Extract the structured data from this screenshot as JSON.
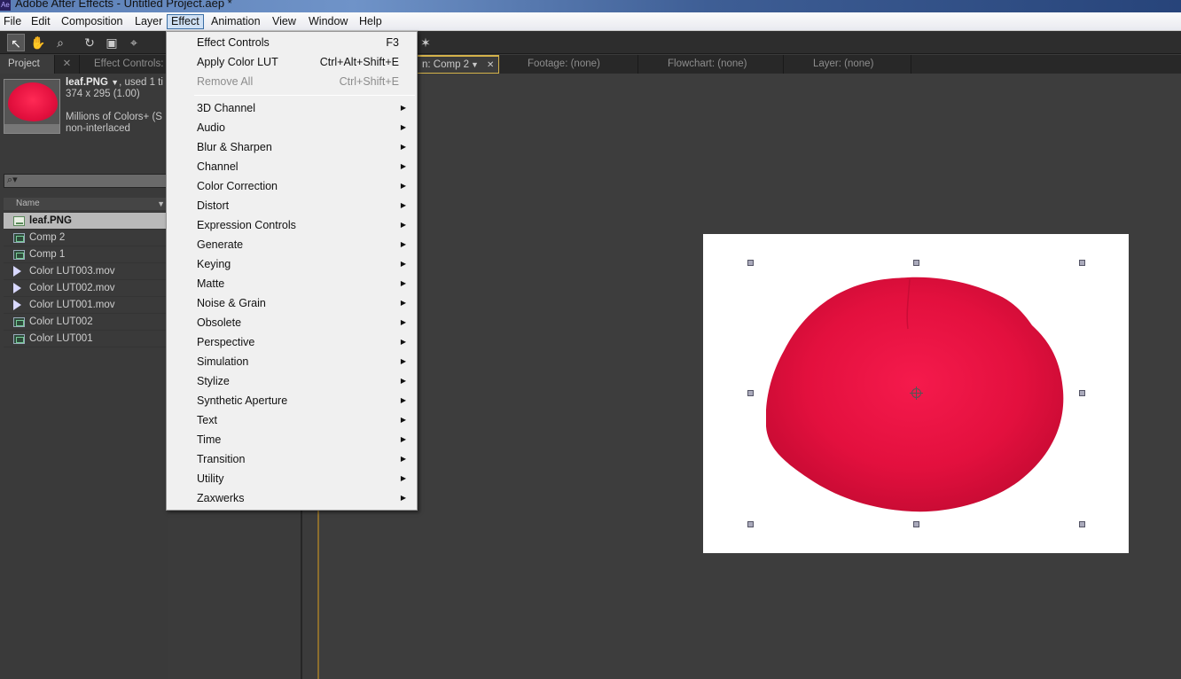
{
  "window": {
    "title": "Adobe After Effects - Untitled Project.aep *",
    "app_icon": "Ae"
  },
  "menubar": [
    "File",
    "Edit",
    "Composition",
    "Layer",
    "Effect",
    "Animation",
    "View",
    "Window",
    "Help"
  ],
  "active_menu": "Effect",
  "tabs": {
    "project": "Project",
    "effect_controls": "Effect Controls:",
    "composition": "n: Comp 2",
    "footage": "Footage: (none)",
    "flowchart": "Flowchart: (none)",
    "layer": "Layer: (none)"
  },
  "project": {
    "selected_name": "leaf.PNG",
    "used_text": ", used 1 ti",
    "dimensions": "374 x 295 (1.00)",
    "colors": "Millions of Colors+ (S",
    "interlace": "non-interlaced",
    "column_name": "Name",
    "items": [
      {
        "name": "leaf.PNG",
        "type": "png"
      },
      {
        "name": "Comp 2",
        "type": "comp"
      },
      {
        "name": "Comp 1",
        "type": "comp"
      },
      {
        "name": "Color LUT003.mov",
        "type": "mov"
      },
      {
        "name": "Color LUT002.mov",
        "type": "mov"
      },
      {
        "name": "Color LUT001.mov",
        "type": "mov"
      },
      {
        "name": "Color LUT002",
        "type": "comp"
      },
      {
        "name": "Color LUT001",
        "type": "comp"
      }
    ]
  },
  "effect_menu": {
    "top": [
      {
        "label": "Effect Controls",
        "shortcut": "F3"
      },
      {
        "label": "Apply Color LUT",
        "shortcut": "Ctrl+Alt+Shift+E"
      },
      {
        "label": "Remove All",
        "shortcut": "Ctrl+Shift+E",
        "disabled": true
      }
    ],
    "categories": [
      "3D Channel",
      "Audio",
      "Blur & Sharpen",
      "Channel",
      "Color Correction",
      "Distort",
      "Expression Controls",
      "Generate",
      "Keying",
      "Matte",
      "Noise & Grain",
      "Obsolete",
      "Perspective",
      "Simulation",
      "Stylize",
      "Synthetic Aperture",
      "Text",
      "Time",
      "Transition",
      "Utility",
      "Zaxwerks"
    ]
  },
  "colors": {
    "petal": "#e8123f",
    "menu_bg": "#f0f0f0",
    "panel_bg": "#3b3b3b",
    "comp_tab_accent": "#d4b24a"
  }
}
